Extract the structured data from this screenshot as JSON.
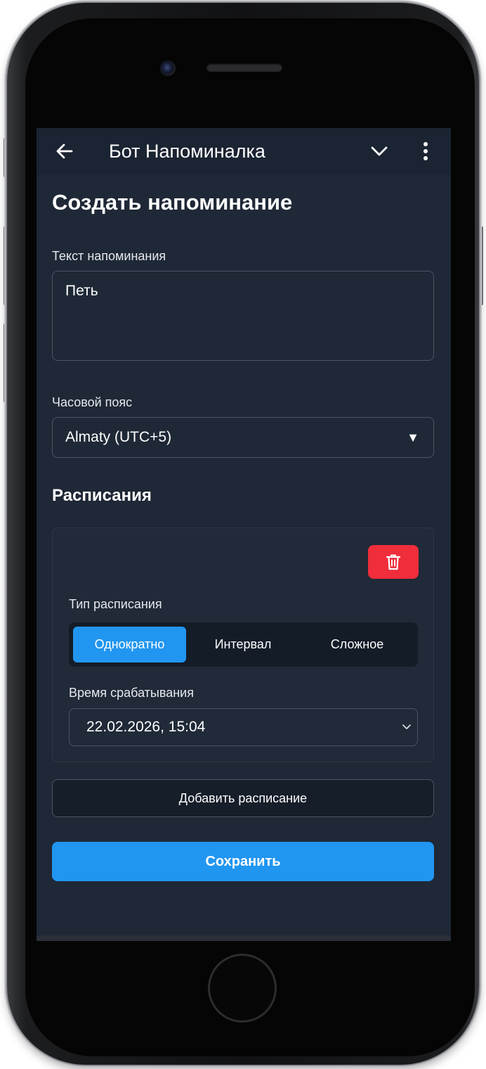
{
  "header": {
    "title": "Бот Напоминалка",
    "icons": {
      "back": "arrow-left-icon",
      "collapse": "chevron-down-icon",
      "menu": "more-vertical-icon"
    }
  },
  "form": {
    "page_title": "Создать напоминание",
    "text_label": "Текст напоминания",
    "text_value": "Петь",
    "timezone_label": "Часовой пояс",
    "timezone_value": "Almaty (UTC+5)",
    "timezone_arrow": "▼"
  },
  "schedules": {
    "section_title": "Расписания",
    "type_label": "Тип расписания",
    "types": [
      "Однократно",
      "Интервал",
      "Сложное"
    ],
    "active_type": "Однократно",
    "trigger_label": "Время срабатывания",
    "trigger_value": "22.02.2026, 15:04",
    "delete_icon": "trash-icon"
  },
  "actions": {
    "add_schedule": "Добавить расписание",
    "save": "Сохранить"
  },
  "colors": {
    "accent": "#2196f0",
    "danger": "#ef2d3b",
    "background": "#1f2836"
  }
}
